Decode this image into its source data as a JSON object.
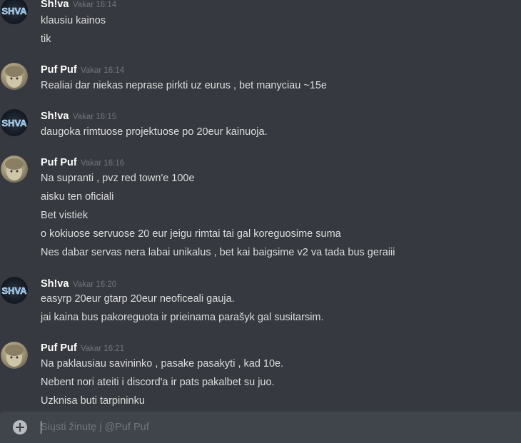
{
  "messages": [
    {
      "author": "Sh!va",
      "time": "Vakar 16:14",
      "avatar": "shiva-avatar",
      "lines": [
        "klausiu kainos",
        "tik"
      ]
    },
    {
      "author": "Puf Puf",
      "time": "Vakar 16:14",
      "avatar": "puf-avatar",
      "lines": [
        "Realiai dar niekas neprase pirkti uz eurus , bet manyciau ~15e"
      ]
    },
    {
      "author": "Sh!va",
      "time": "Vakar 16:15",
      "avatar": "shiva-avatar",
      "lines": [
        "daugoka rimtuose projektuose po 20eur kainuoja."
      ]
    },
    {
      "author": "Puf Puf",
      "time": "Vakar 16:16",
      "avatar": "puf-avatar",
      "lines": [
        "Na supranti , pvz red town'e 100e",
        "aisku ten oficiali",
        "Bet vistiek",
        "o kokiuose servuose 20 eur jeigu rimtai tai gal koreguosime suma",
        "Nes dabar servas nera labai unikalus , bet kai baigsime v2 va tada bus geraiii"
      ]
    },
    {
      "author": "Sh!va",
      "time": "Vakar 16:20",
      "avatar": "shiva-avatar",
      "lines": [
        "easyrp 20eur gtarp 20eur neoficeali gauja.",
        "jai kaina bus pakoreguota ir prieinama parašyk gal susitarsim."
      ]
    },
    {
      "author": "Puf Puf",
      "time": "Vakar 16:21",
      "avatar": "puf-avatar",
      "lines": [
        "Na paklausiau savininko , pasake pasakyti , kad 10e.",
        "Nebent nori ateiti i discord'a ir pats pakalbet su juo.",
        "Uzknisa buti tarpininku"
      ]
    }
  ],
  "avatar_text": "SHVA",
  "composer": {
    "placeholder": "Siųsti žinutę į @Puf Puf",
    "add_icon": "plus-circle-icon"
  },
  "colors": {
    "background": "#36393f",
    "composer": "#40444b",
    "username": "#ffffff",
    "timestamp": "#72767d",
    "text": "#dcddde"
  }
}
